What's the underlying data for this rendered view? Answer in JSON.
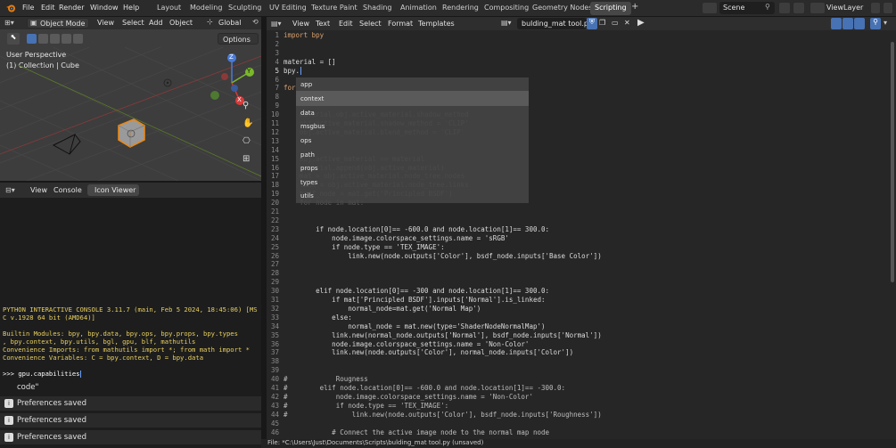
{
  "topbar": {
    "menus": [
      "File",
      "Edit",
      "Render",
      "Window",
      "Help"
    ],
    "workspaces": [
      "Layout",
      "Modeling",
      "Sculpting",
      "UV Editing",
      "Texture Paint",
      "Shading",
      "Animation",
      "Rendering",
      "Compositing",
      "Geometry Nodes",
      "Scripting"
    ],
    "active_workspace": "Scripting",
    "plus": "+",
    "scene": "Scene",
    "view_layer": "ViewLayer"
  },
  "viewport": {
    "mode": "Object Mode",
    "menus": [
      "View",
      "Select",
      "Add",
      "Object"
    ],
    "orientation": "Global",
    "options": "Options",
    "perspective": "User Perspective",
    "collection": "(1) Collection | Cube",
    "gizmo": {
      "z": "Z",
      "y": "Y",
      "x": "X"
    }
  },
  "console": {
    "menus": [
      "View",
      "Console",
      "Icon Viewer"
    ],
    "active_tab": "Icon Viewer",
    "lines": [
      "PYTHON INTERACTIVE CONSOLE 3.11.7 (main, Feb  5 2024, 18:45:06) [MS",
      "C v.1928 64 bit (AMD64)]",
      "",
      "Builtin Modules:       bpy, bpy.data, bpy.ops, bpy.props, bpy.types",
      ", bpy.context, bpy.utils, bgl, gpu, blf, mathutils",
      "Convenience Imports:   from mathutils import *; from math import *",
      "Convenience Variables: C = bpy.context, D = bpy.data"
    ],
    "prompt": ">>> ",
    "input": "gpu.capabilities"
  },
  "reports": {
    "partial": "code\"",
    "items": [
      "Preferences saved",
      "Preferences saved",
      "Preferences saved"
    ]
  },
  "editor": {
    "menus": [
      "View",
      "Text",
      "Edit",
      "Select",
      "Format",
      "Templates"
    ],
    "filename": "bulding_mat tool.py",
    "line_numbers": [
      "1",
      "2",
      "3",
      "4",
      "5",
      "6",
      "7",
      "8",
      "9",
      "10",
      "11",
      "12",
      "13",
      "14",
      "15",
      "16",
      "17",
      "18",
      "19",
      "20",
      "21",
      "22",
      "23",
      "24",
      "25",
      "26",
      "27",
      "28",
      "29",
      "30",
      "31",
      "32",
      "33",
      "34",
      "35",
      "36",
      "37",
      "38",
      "39",
      "40",
      "41",
      "42",
      "43",
      "44",
      "45",
      "46"
    ],
    "code": [
      "import bpy",
      "",
      "",
      "material = []",
      "bpy.",
      "",
      "for",
      "",
      "",
      "    material.obj.active_material.shadow_method",
      "    obj.active_material.shadow_method = 'CLIP'",
      "    obj.active_material.blend_method = 'CLIP'",
      "",
      "",
      "    obj.active_material == material",
      "    material.append(obj.active_material)",
      "    mat = obj.active_material.node_tree.nodes",
      "    link = obj.active_material.node_tree.links",
      "    bsdf_node = mat.get('Principled BSDF')",
      "    for node in mat:",
      "",
      "",
      "        if node.location[0]== -600.0 and node.location[1]== 300.0:",
      "            node.image.colorspace_settings.name = 'sRGB'",
      "            if node.type == 'TEX_IMAGE':",
      "                link.new(node.outputs['Color'], bsdf_node.inputs['Base Color'])",
      "",
      "",
      "",
      "        elif node.location[0]== -300 and node.location[1]== 300.0:",
      "            if mat['Principled BSDF'].inputs['Normal'].is_linked:",
      "                normal_node=mat.get('Normal Map')",
      "            else:",
      "                normal_node = mat.new(type='ShaderNodeNormalMap')",
      "            link.new(normal_node.outputs['Normal'], bsdf_node.inputs['Normal'])",
      "            node.image.colorspace_settings.name = 'Non-Color'",
      "            link.new(node.outputs['Color'], normal_node.inputs['Color'])",
      "",
      "",
      "#            Rougness",
      "#        elif node.location[0]== -600.0 and node.location[1]== -300.0:",
      "#            node.image.colorspace_settings.name = 'Non-Color'",
      "#            if node.type == 'TEX_IMAGE':",
      "#                link.new(node.outputs['Color'], bsdf_node.inputs['Roughness'])",
      "",
      "            # Connect the active image node to the normal map node"
    ]
  },
  "autocomplete": {
    "items": [
      "app",
      "context",
      "data",
      "msgbus",
      "ops",
      "path",
      "props",
      "types",
      "utils"
    ],
    "selected": "context"
  },
  "statusbar": {
    "text": "File: *C:\\Users\\Just\\Documents\\Scripts\\bulding_mat tool.py (unsaved)"
  }
}
